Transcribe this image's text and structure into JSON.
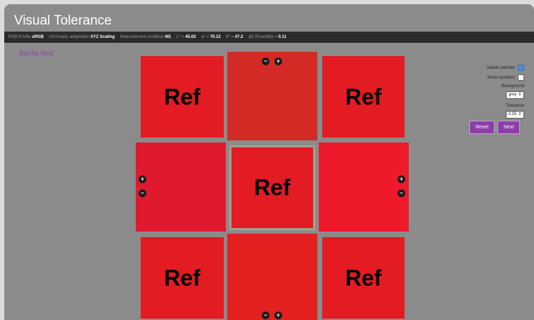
{
  "title": "Visual Tolerance",
  "info": [
    {
      "label": "RGB Profile",
      "value": "sRGB"
    },
    {
      "label": "Chromatic adaptation",
      "value": "XYZ Scaling"
    },
    {
      "label": "Measurement condition",
      "value": "M1"
    },
    {
      "label": "L* =",
      "value": "45.02"
    },
    {
      "label": "a* =",
      "value": "70.12"
    },
    {
      "label": "b* =",
      "value": "47.2"
    },
    {
      "label": "ΔE Roundtrip =",
      "value": "0.11"
    }
  ],
  "subject_name": "Barilla Red",
  "ref_label": "Ref",
  "patch_colors": {
    "ref": "#e31b23",
    "top": "#d42a26",
    "left": "#e01a2e",
    "right": "#ee1a2c",
    "bottom": "#e32120",
    "frame": "#a4a08c"
  },
  "controls": {
    "minus": "−",
    "plus": "+"
  },
  "sidebar": {
    "isolate_label": "Isolate patches",
    "isolate_checked": true,
    "show_numbers_label": "Show numbers",
    "show_numbers_checked": false,
    "background_label": "Background",
    "background_value": "grey",
    "tolerance_label": "Tolerance",
    "tolerance_value": "0.05",
    "reset_label": "Reset",
    "next_label": "Next"
  }
}
